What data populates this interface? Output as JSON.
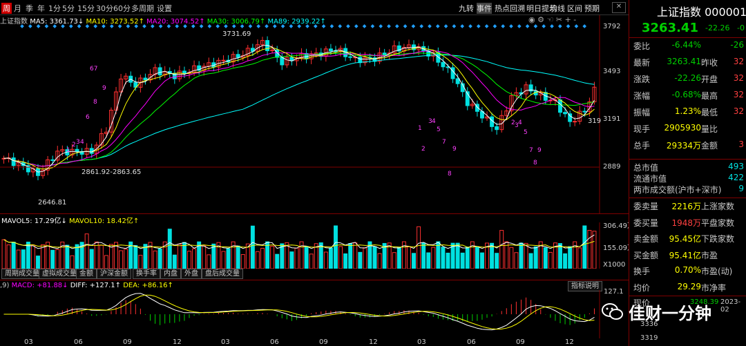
{
  "toolbar": {
    "periods": [
      "周",
      "月",
      "季",
      "年",
      "1分",
      "5分",
      "15分",
      "30分",
      "60分",
      "多周期",
      "设置"
    ],
    "active_period": "周",
    "right_items": [
      "九转",
      "事件",
      "热点回溯",
      "明日提示",
      "均线",
      "区间",
      "预期"
    ]
  },
  "main": {
    "index_name": "上证指数",
    "ma_legend": [
      {
        "label": "MA5: 3361.73↓",
        "color": "#ffffff"
      },
      {
        "label": "MA10: 3273.52↑",
        "color": "#ffff00"
      },
      {
        "label": "MA20: 3074.52↑",
        "color": "#ff00ff"
      },
      {
        "label": "MA30: 3006.79↑",
        "color": "#00ff00"
      },
      {
        "label": "MA89: 2939.22↑",
        "color": "#00ffff"
      }
    ],
    "price_axis": [
      "3792",
      "3493",
      "3191",
      "2889"
    ],
    "annotations": {
      "high": "3731.69",
      "low": "2646.81",
      "range": "2861.92-2863.65",
      "cur_tag": "319"
    }
  },
  "volume": {
    "legend": [
      {
        "label": "MAVOL5: 17.29亿↓",
        "color": "#ffffff"
      },
      {
        "label": "MAVOL10: 18.42亿↑",
        "color": "#ffff00"
      }
    ],
    "axis": [
      "306.49万",
      "155.09万",
      "X1000"
    ]
  },
  "tabs": [
    "周期成交量",
    "虚拟成交量",
    "金额",
    "沪深金额",
    "换手率",
    "内盘",
    "外盘",
    "盘后成交量"
  ],
  "macd": {
    "legend": [
      {
        "label": "MACD: +81.88↓",
        "color": "#ff00ff"
      },
      {
        "label": "DIFF: +127.1↑",
        "color": "#ffffff"
      },
      {
        "label": "DEA: +86.16↑",
        "color": "#ffff00"
      }
    ],
    "prefix": ",9)",
    "axis_label": "127.1",
    "help_button": "指标说明"
  },
  "x_axis": [
    "03",
    "06",
    "09",
    "12",
    "03",
    "06",
    "09",
    "12",
    "03",
    "06",
    "09",
    "12"
  ],
  "quote_panel": {
    "title": "上证指数 000001",
    "price": "3263.41",
    "change": "-22.26",
    "change_trunc": "-0",
    "rows": [
      {
        "label": "委比",
        "value": "-6.44%",
        "color": "green",
        "label2": "",
        "value2": "-26"
      },
      {
        "label": "最新",
        "value": "3263.41",
        "color": "green",
        "label2": "昨收",
        "value2": "32"
      },
      {
        "label": "涨跌",
        "value": "-22.26",
        "color": "green",
        "label2": "开盘",
        "value2": "32"
      },
      {
        "label": "涨幅",
        "value": "-0.68%",
        "color": "green",
        "label2": "最高",
        "value2": "32"
      },
      {
        "label": "振幅",
        "value": "1.23%",
        "color": "yel",
        "label2": "最低",
        "value2": "32"
      },
      {
        "label": "现手",
        "value": "2905930",
        "color": "yel",
        "label2": "量比",
        "value2": ""
      },
      {
        "label": "总手",
        "value": "29334万",
        "color": "yel",
        "label2": "金额",
        "value2": "3"
      }
    ],
    "market_rows": [
      {
        "label": "总市值",
        "value": "493"
      },
      {
        "label": "流通市值",
        "value": "422"
      },
      {
        "label": "两市成交额(沪市+深市)",
        "value": "9"
      }
    ],
    "flow_rows": [
      {
        "label": "委卖量",
        "value": "2216万",
        "color": "yel",
        "label2": "上涨家数"
      },
      {
        "label": "委买量",
        "value": "1948万",
        "color": "red",
        "label2": "平盘家数"
      },
      {
        "label": "卖金额",
        "value": "95.45亿",
        "color": "yel",
        "label2": "下跌家数"
      },
      {
        "label": "买金额",
        "value": "95.41亿",
        "color": "yel",
        "label2": "市盈"
      },
      {
        "label": "换手",
        "value": "0.70%",
        "color": "yel",
        "label2": "市盈(动)"
      },
      {
        "label": "均价",
        "value": "29.29",
        "color": "yel",
        "label2": "市净率"
      }
    ],
    "bottom": {
      "label": "现价",
      "value": "3248.39",
      "date": "2023-02"
    },
    "ticks": [
      "3336",
      "3319"
    ]
  },
  "watermark": {
    "text": "佳财一分钟"
  }
}
